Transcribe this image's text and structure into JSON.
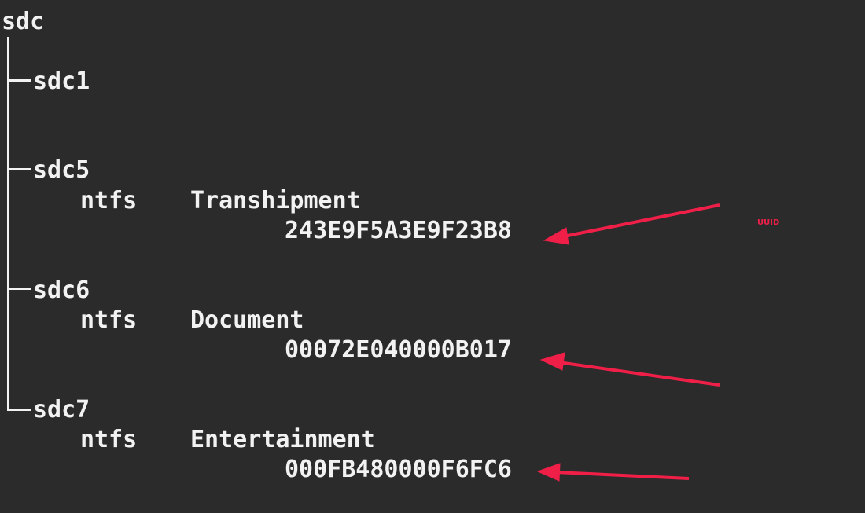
{
  "disk": "sdc",
  "partitions": [
    {
      "name": "sdc1",
      "fstype": "",
      "label": "",
      "uuid": ""
    },
    {
      "name": "sdc5",
      "fstype": "ntfs",
      "label": "Transhipment",
      "uuid": "243E9F5A3E9F23B8"
    },
    {
      "name": "sdc6",
      "fstype": "ntfs",
      "label": "Document",
      "uuid": "00072E040000B017"
    },
    {
      "name": "sdc7",
      "fstype": "ntfs",
      "label": "Entertainment",
      "uuid": "000FB480000F6FC6"
    }
  ],
  "annotation": {
    "text": "UUID",
    "color": "#ef1f48"
  },
  "colors": {
    "background": "#2b2b2b",
    "text": "#f2f2f2",
    "arrow": "#ef1f48"
  }
}
